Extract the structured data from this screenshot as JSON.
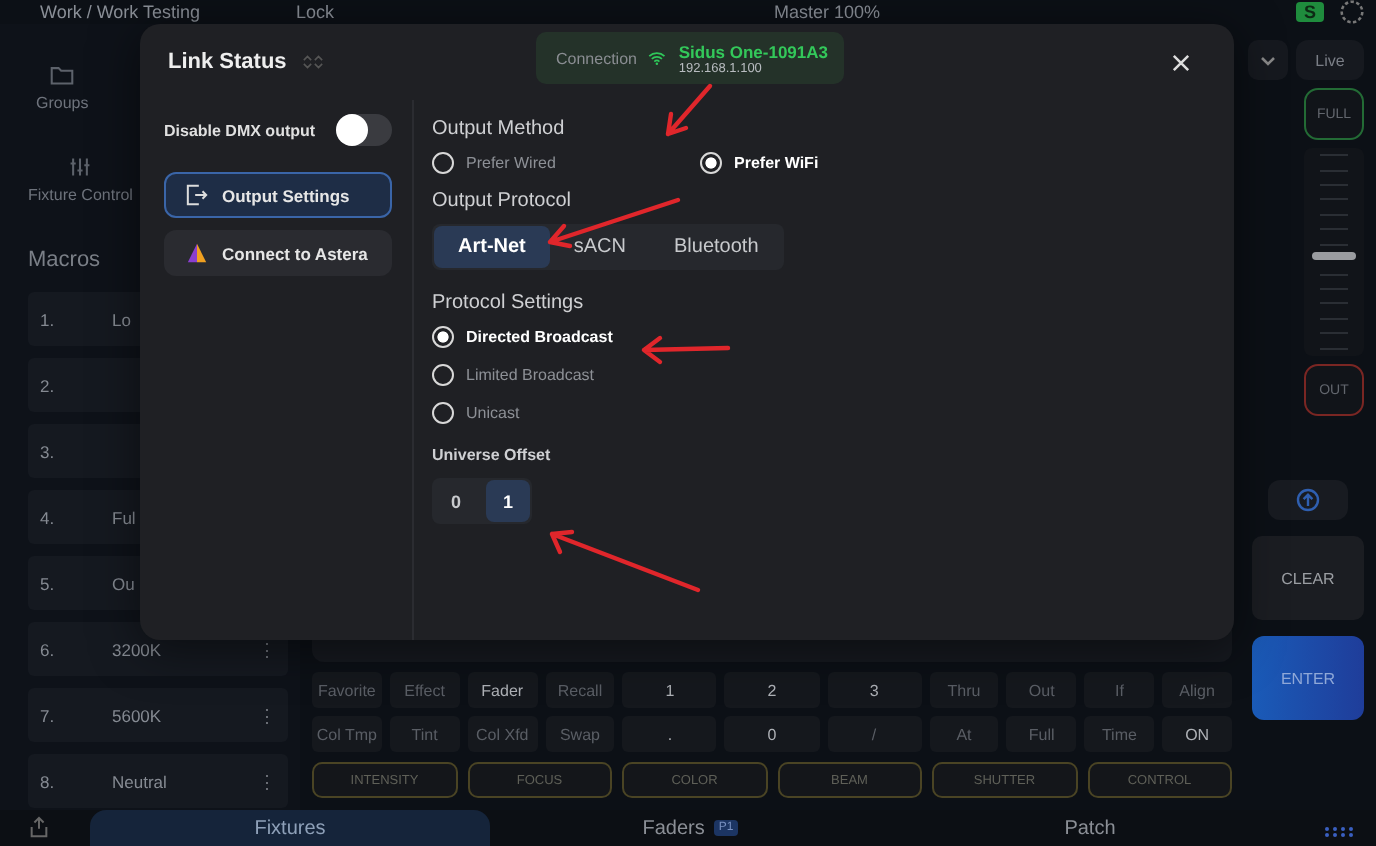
{
  "top_bar": {
    "breadcrumb": "Work / Work Testing",
    "lock": "Lock",
    "master": "Master 100%",
    "badge": "S"
  },
  "sidebar": {
    "nav": [
      {
        "label": "Groups"
      },
      {
        "label": "Fixture Control"
      }
    ],
    "macros_title": "Macros",
    "macros": [
      {
        "number": "1.",
        "name": "Lo"
      },
      {
        "number": "2."
      },
      {
        "number": "3."
      },
      {
        "number": "4.",
        "name": "Ful"
      },
      {
        "number": "5.",
        "name": "Ou"
      },
      {
        "number": "6.",
        "name": "3200K",
        "menu": "⋮"
      },
      {
        "number": "7.",
        "name": "5600K",
        "menu": "⋮"
      },
      {
        "number": "8.",
        "name": "Neutral",
        "menu": "⋮"
      }
    ]
  },
  "right_controls": {
    "live": "Live",
    "full": "FULL",
    "fader": {
      "level": 0.52
    },
    "out": "OUT",
    "clear": "CLEAR",
    "enter": "ENTER"
  },
  "keypad": {
    "keys": [
      {
        "label": "Favorite",
        "disabled": true
      },
      {
        "label": "Effect",
        "disabled": true
      },
      {
        "label": "Fader",
        "disabled": false
      },
      {
        "label": "Recall",
        "disabled": true
      },
      {
        "label": "1",
        "disabled": false
      },
      {
        "label": "2",
        "disabled": false
      },
      {
        "label": "3",
        "disabled": false
      },
      {
        "label": "Thru",
        "disabled": true
      },
      {
        "label": "Out",
        "disabled": true
      },
      {
        "label": "If",
        "disabled": true
      },
      {
        "label": "Align",
        "disabled": true
      },
      {
        "label": "Col Tmp",
        "disabled": true
      },
      {
        "label": "Tint",
        "disabled": true
      },
      {
        "label": "Col Xfd",
        "disabled": true
      },
      {
        "label": "Swap",
        "disabled": true
      },
      {
        "label": ".",
        "disabled": false
      },
      {
        "label": "0",
        "disabled": false
      },
      {
        "label": "/",
        "disabled": true
      },
      {
        "label": "At",
        "disabled": true
      },
      {
        "label": "Full",
        "disabled": true
      },
      {
        "label": "Time",
        "disabled": true
      },
      {
        "label": "ON",
        "disabled": false
      }
    ],
    "categories": [
      "INTENSITY",
      "FOCUS",
      "COLOR",
      "BEAM",
      "SHUTTER",
      "CONTROL"
    ]
  },
  "bottom_tabs": [
    {
      "label": "Fixtures",
      "selected": true
    },
    {
      "label": "Faders",
      "badge": "P1",
      "selected": false
    },
    {
      "label": "Patch",
      "selected": false
    }
  ],
  "link_status": {
    "title": "Link Status",
    "connection": {
      "label": "Connection",
      "name": "Sidus One-1091A3",
      "address": "192.168.1.100"
    },
    "disable_dmx": {
      "label": "Disable DMX output",
      "on": false
    },
    "nav": [
      {
        "label": "Output Settings",
        "selected": true
      },
      {
        "label": "Connect to Astera",
        "selected": false
      }
    ],
    "output_method": {
      "title": "Output Method",
      "options": [
        {
          "label": "Prefer Wired",
          "selected": false
        },
        {
          "label": "Prefer WiFi",
          "selected": true
        }
      ]
    },
    "output_protocol": {
      "title": "Output Protocol",
      "options": [
        {
          "label": "Art-Net",
          "selected": true
        },
        {
          "label": "sACN",
          "selected": false
        },
        {
          "label": "Bluetooth",
          "selected": false
        }
      ]
    },
    "protocol_settings": {
      "title": "Protocol Settings",
      "options": [
        {
          "label": "Directed Broadcast",
          "selected": true
        },
        {
          "label": "Limited Broadcast",
          "selected": false
        },
        {
          "label": "Unicast",
          "selected": false
        }
      ]
    },
    "universe_offset": {
      "title": "Universe Offset",
      "options": [
        {
          "label": "0",
          "selected": false
        },
        {
          "label": "1",
          "selected": true
        }
      ]
    }
  }
}
